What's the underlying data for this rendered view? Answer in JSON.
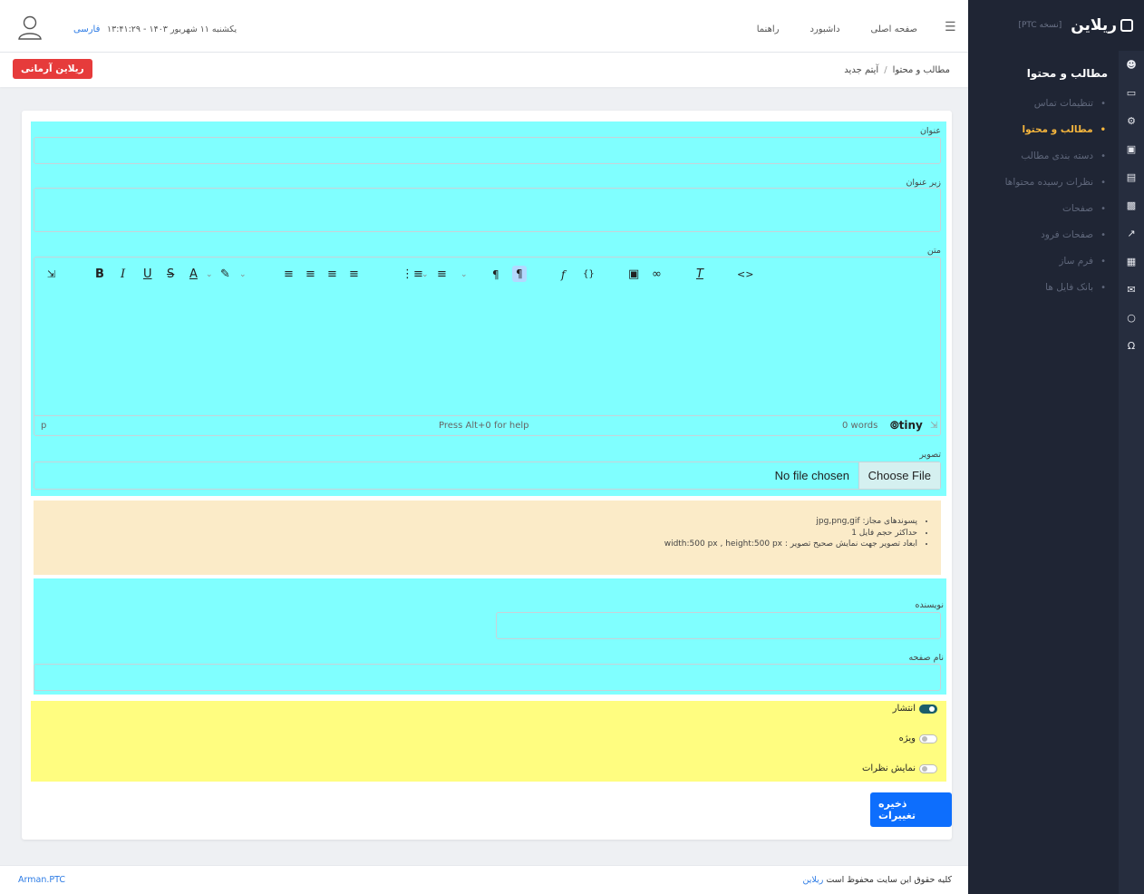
{
  "sidebar": {
    "logo_text": "ریلاین",
    "logo_sub": "[نسخه PTC]",
    "section_title": "مطالب و محتوا",
    "items": [
      {
        "label": "تنظیمات تماس",
        "active": false
      },
      {
        "label": "مطالب و محتوا",
        "active": true
      },
      {
        "label": "دسته بندی مطالب",
        "active": false
      },
      {
        "label": "نظرات رسیده محتواها",
        "active": false
      },
      {
        "label": "صفحات",
        "active": false
      },
      {
        "label": "صفحات فرود",
        "active": false
      },
      {
        "label": "فرم ساز",
        "active": false
      },
      {
        "label": "بانک فایل ها",
        "active": false
      }
    ],
    "rail_icons": [
      "users-icon",
      "monitor-icon",
      "gear-icon",
      "basket-icon",
      "newspaper-icon",
      "image-icon",
      "chart-icon",
      "document-icon",
      "mail-icon",
      "chat-icon",
      "headset-icon"
    ]
  },
  "topbar": {
    "nav": [
      "صفحه اصلی",
      "داشبورد",
      "راهنما"
    ],
    "datetime": "یکشنبه ۱۱ شهریور ۱۴۰۳ - ۱۳:۴۱:۲۹",
    "language": "فارسی"
  },
  "subbar": {
    "breadcrumb_parent": "مطالب و محتوا",
    "breadcrumb_sep": "/",
    "breadcrumb_current": "آیتم جدید",
    "brand_button": "ریلاین آرمانی"
  },
  "form": {
    "title_label": "عنوان",
    "subtitle_label": "زیر عنوان",
    "body_label": "متن",
    "image_label": "تصویر",
    "choose_file": "Choose File",
    "no_file": "No file chosen",
    "hints": [
      "پسوندهای مجاز: jpg,png,gif",
      "حداکثر حجم فایل 1",
      "ابعاد تصویر جهت نمایش صحیح تصویر : width:500 px , height:500 px"
    ],
    "author_label": "نویسنده",
    "page_name_label": "نام صفحه",
    "toggles": [
      {
        "label": "انتشار",
        "on": true
      },
      {
        "label": "ویژه",
        "on": false
      },
      {
        "label": "نمایش نظرات",
        "on": false
      }
    ],
    "save_button": "ذخیره تغییرات"
  },
  "editor": {
    "status_path": "p",
    "status_help": "Press Alt+0 for help",
    "word_count": "0 words",
    "brand": "tiny"
  },
  "footer": {
    "left": "Arman.PTC",
    "right_text": "کلیه حقوق این سایت محفوظ است",
    "right_link": "ریلاین"
  },
  "colors": {
    "sidebar_bg": "#1f2534",
    "active_menu": "#f6b63d",
    "highlight_cyan": "#80ffff",
    "highlight_yellow": "#fffd80",
    "warning_bg": "#fbebc8",
    "save_blue": "#0d6efd",
    "brand_red": "#e63b3b"
  }
}
